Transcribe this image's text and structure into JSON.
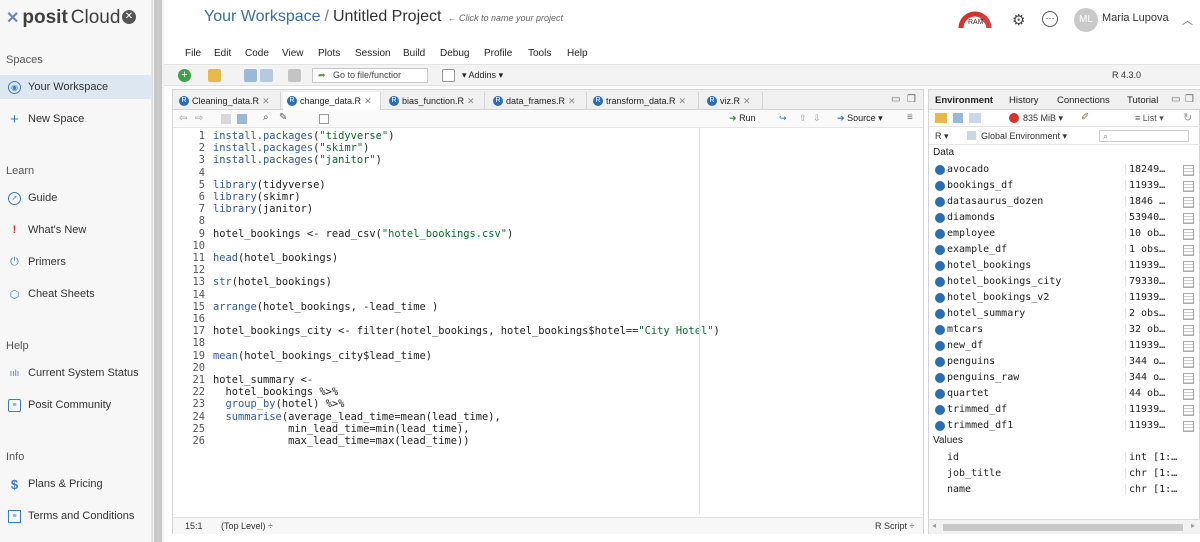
{
  "brand": {
    "name": "posit",
    "product": "Cloud"
  },
  "sidebar": {
    "spaces_label": "Spaces",
    "workspace": "Your Workspace",
    "new_space": "New Space",
    "learn_label": "Learn",
    "learn_items": [
      "Guide",
      "What's New",
      "Primers",
      "Cheat Sheets"
    ],
    "help_label": "Help",
    "help_items": [
      "Current System Status",
      "Posit Community"
    ],
    "info_label": "Info",
    "info_items": [
      "Plans & Pricing",
      "Terms and Conditions"
    ]
  },
  "header": {
    "workspace": "Your Workspace",
    "separator": "/",
    "project": "Untitled Project",
    "hint": "← Click to name your project",
    "ram": "RAM",
    "user_initials": "ML",
    "user_name": "Maria Lupova"
  },
  "menu": [
    "File",
    "Edit",
    "Code",
    "View",
    "Plots",
    "Session",
    "Build",
    "Debug",
    "Profile",
    "Tools",
    "Help"
  ],
  "toolbar": {
    "goto_placeholder": "Go to file/functior",
    "addins": "Addins",
    "r_version": "R 4.3.0"
  },
  "editor": {
    "tabs": [
      "Cleaning_data.R",
      "change_data.R",
      "bias_function.R",
      "data_frames.R",
      "transform_data.R",
      "viz.R"
    ],
    "active_tab": 1,
    "run": "Run",
    "source": "Source",
    "lines": [
      "install.packages(\"tidyverse\")",
      "install.packages(\"skimr\")",
      "install.packages(\"janitor\")",
      "",
      "library(tidyverse)",
      "library(skimr)",
      "library(janitor)",
      "",
      "hotel_bookings <- read_csv(\"hotel_bookings.csv\")",
      "",
      "head(hotel_bookings)",
      "",
      "str(hotel_bookings)",
      "",
      "arrange(hotel_bookings, -lead_time )",
      "",
      "hotel_bookings_city <- filter(hotel_bookings, hotel_bookings$hotel==\"City Hotel\")",
      "",
      "mean(hotel_bookings_city$lead_time)",
      "",
      "hotel_summary <-",
      "  hotel_bookings %>%",
      "  group_by(hotel) %>%",
      "  summarise(average_lead_time=mean(lead_time),",
      "            min_lead_time=min(lead_time),",
      "            max_lead_time=max(lead_time))"
    ],
    "cursor_pos": "15:1",
    "scope": "(Top Level) ÷",
    "filetype": "R Script ÷"
  },
  "environment": {
    "tabs": [
      "Environment",
      "History",
      "Connections",
      "Tutorial"
    ],
    "memory": "835 MiB",
    "list_label": "List",
    "r_label": "R",
    "scope": "Global Environment",
    "data_label": "Data",
    "data": [
      {
        "name": "avocado",
        "value": "18249…"
      },
      {
        "name": "bookings_df",
        "value": "11939…"
      },
      {
        "name": "datasaurus_dozen",
        "value": "1846 …"
      },
      {
        "name": "diamonds",
        "value": "53940…"
      },
      {
        "name": "employee",
        "value": "10 ob…"
      },
      {
        "name": "example_df",
        "value": "1 obs…"
      },
      {
        "name": "hotel_bookings",
        "value": "11939…"
      },
      {
        "name": "hotel_bookings_city",
        "value": "79330…"
      },
      {
        "name": "hotel_bookings_v2",
        "value": "11939…"
      },
      {
        "name": "hotel_summary",
        "value": "2 obs…"
      },
      {
        "name": "mtcars",
        "value": "32 ob…"
      },
      {
        "name": "new_df",
        "value": "11939…"
      },
      {
        "name": "penguins",
        "value": "344 o…"
      },
      {
        "name": "penguins_raw",
        "value": "344 o…"
      },
      {
        "name": "quartet",
        "value": "44 ob…"
      },
      {
        "name": "trimmed_df",
        "value": "11939…"
      },
      {
        "name": "trimmed_df1",
        "value": "11939…"
      }
    ],
    "values_label": "Values",
    "values": [
      {
        "name": "id",
        "value": "int [1:…"
      },
      {
        "name": "job_title",
        "value": "chr [1:…"
      },
      {
        "name": "name",
        "value": "chr [1:…"
      }
    ]
  }
}
